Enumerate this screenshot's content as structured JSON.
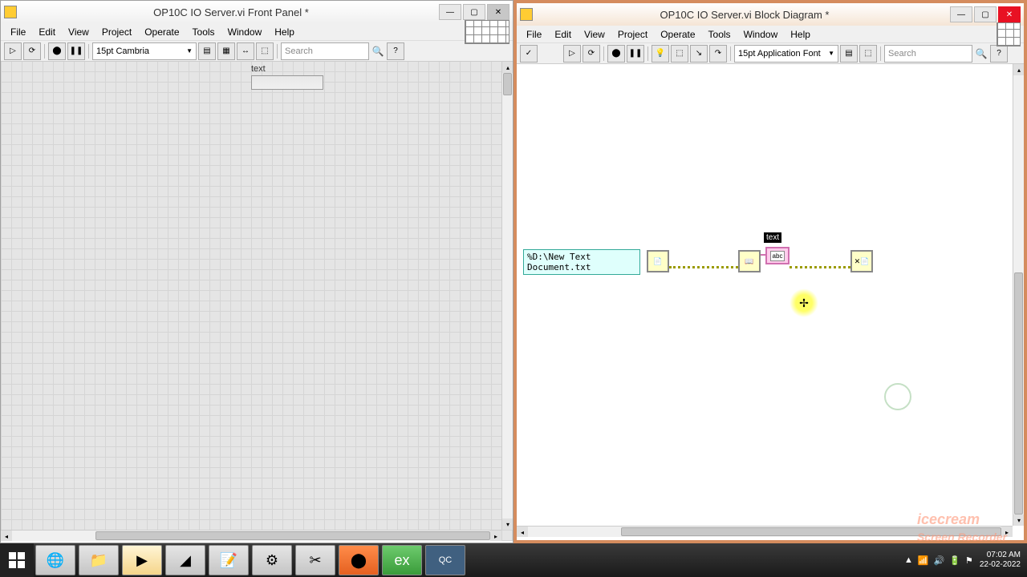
{
  "front_panel": {
    "title": "OP10C IO Server.vi Front Panel *",
    "menu": [
      "File",
      "Edit",
      "View",
      "Project",
      "Operate",
      "Tools",
      "Window",
      "Help"
    ],
    "font": "15pt Cambria",
    "search_placeholder": "Search",
    "label": "text"
  },
  "block_diagram": {
    "title": "OP10C IO Server.vi Block Diagram *",
    "menu": [
      "File",
      "Edit",
      "View",
      "Project",
      "Operate",
      "Tools",
      "Window",
      "Help"
    ],
    "font": "15pt Application Font",
    "search_placeholder": "Search",
    "path_value": "%D:\\New Text Document.txt",
    "indicator_label": "text",
    "indicator_type": "abc"
  },
  "taskbar": {
    "time": "07:02 AM",
    "date": "22-02-2022"
  },
  "watermark": "Screen Recorder"
}
